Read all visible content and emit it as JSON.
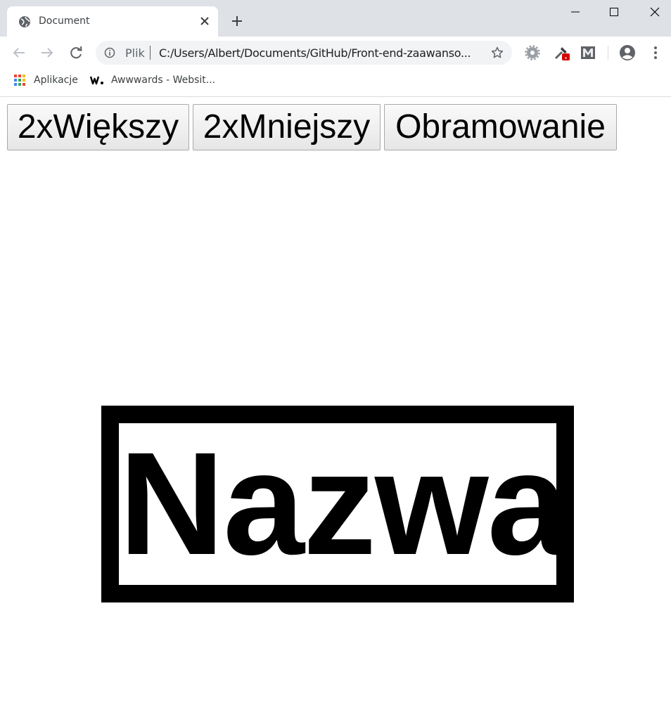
{
  "browser": {
    "tab": {
      "title": "Document"
    },
    "omnibox": {
      "scheme_label": "Plik",
      "url": "C:/Users/Albert/Documents/GitHub/Front-end-zaawanso..."
    },
    "bookmarks": [
      {
        "label": "Aplikacje",
        "icon": "apps-grid-icon"
      },
      {
        "label": "Awwwards - Websit...",
        "icon": "awwwards-icon"
      }
    ],
    "extensions": [
      "settings-gear-icon",
      "eyedropper-icon",
      "m-logo-icon"
    ]
  },
  "page": {
    "buttons": {
      "bigger": "2xWiększy",
      "smaller": "2xMniejszy",
      "border": "Obramowanie"
    },
    "name_text": "Nazwa"
  }
}
